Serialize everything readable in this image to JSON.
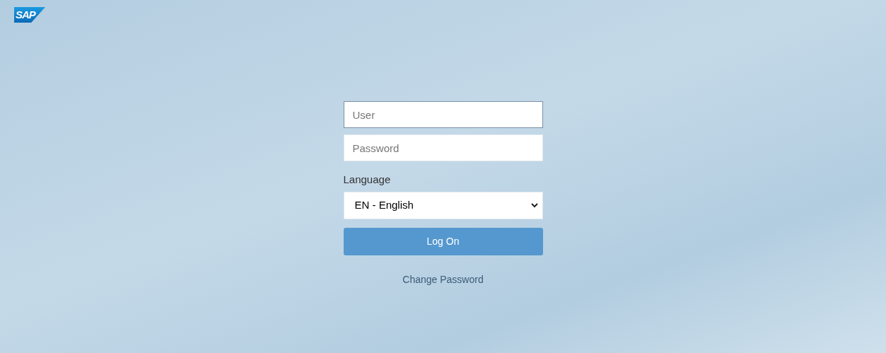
{
  "logo": {
    "text": "SAP"
  },
  "fields": [
    {
      "placeholder": "User",
      "focused": true
    },
    {
      "placeholder": "Password",
      "focused": false
    }
  ],
  "language": {
    "label": "Language",
    "value": "EN - English"
  },
  "log_on_button": {
    "label": "Log On"
  },
  "change_password_link": {
    "label": "Change Password"
  }
}
